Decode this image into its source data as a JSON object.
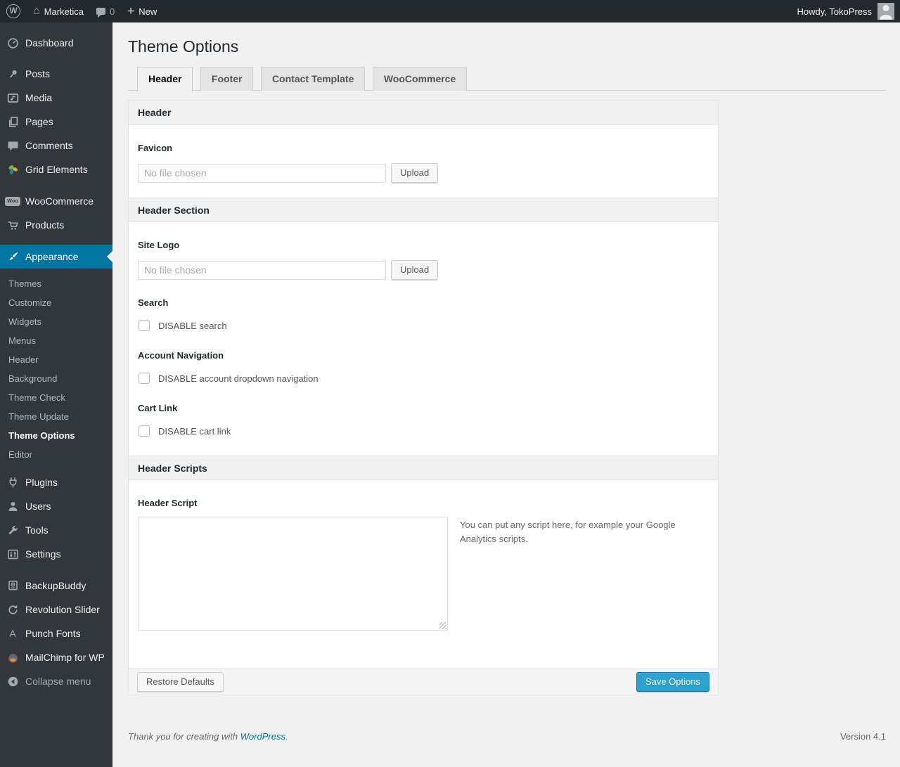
{
  "admin_bar": {
    "site_name": "Marketica",
    "comment_count": "0",
    "new_label": "New",
    "howdy": "Howdy, TokoPress"
  },
  "sidebar": {
    "items": [
      {
        "label": "Dashboard"
      },
      {
        "label": "Posts"
      },
      {
        "label": "Media"
      },
      {
        "label": "Pages"
      },
      {
        "label": "Comments"
      },
      {
        "label": "Grid Elements"
      },
      {
        "label": "WooCommerce"
      },
      {
        "label": "Products"
      },
      {
        "label": "Appearance"
      },
      {
        "label": "Plugins"
      },
      {
        "label": "Users"
      },
      {
        "label": "Tools"
      },
      {
        "label": "Settings"
      },
      {
        "label": "BackupBuddy"
      },
      {
        "label": "Revolution Slider"
      },
      {
        "label": "Punch Fonts"
      },
      {
        "label": "MailChimp for WP"
      },
      {
        "label": "Collapse menu"
      }
    ],
    "submenu": [
      "Themes",
      "Customize",
      "Widgets",
      "Menus",
      "Header",
      "Background",
      "Theme Check",
      "Theme Update",
      "Theme Options",
      "Editor"
    ],
    "current_item": "Appearance",
    "current_submenu_item": "Theme Options",
    "icon_texts": {
      "wp_logo": "W",
      "woocommerce_badge": "Woo",
      "punch_fonts": "A"
    }
  },
  "page": {
    "title": "Theme Options",
    "tabs": [
      {
        "label": "Header",
        "active": true
      },
      {
        "label": "Footer",
        "active": false
      },
      {
        "label": "Contact Template",
        "active": false
      },
      {
        "label": "WooCommerce",
        "active": false
      }
    ]
  },
  "form": {
    "section_header": "Header",
    "section_header_section": "Header Section",
    "section_header_scripts": "Header Scripts",
    "favicon": {
      "label": "Favicon",
      "placeholder": "No file chosen",
      "button": "Upload"
    },
    "site_logo": {
      "label": "Site Logo",
      "placeholder": "No file chosen",
      "button": "Upload"
    },
    "search": {
      "label": "Search",
      "checkbox_label": "DISABLE search",
      "checked": false
    },
    "account_navigation": {
      "label": "Account Navigation",
      "checkbox_label": "DISABLE account dropdown navigation",
      "checked": false
    },
    "cart_link": {
      "label": "Cart Link",
      "checkbox_label": "DISABLE cart link",
      "checked": false
    },
    "header_script": {
      "label": "Header Script",
      "value": "",
      "hint": "You can put any script here, for example your Google Analytics scripts."
    },
    "restore_button": "Restore Defaults",
    "save_button": "Save Options"
  },
  "page_footer": {
    "thanks_prefix": "Thank you for creating with ",
    "link": "WordPress",
    "suffix": ".",
    "version": "Version 4.1"
  },
  "colors": {
    "accent": "#0074a2",
    "primary_button": "#2ea2cc",
    "admin_bar_bg": "#23282d",
    "menu_bg": "#32373c",
    "page_bg": "#f1f1f1"
  }
}
